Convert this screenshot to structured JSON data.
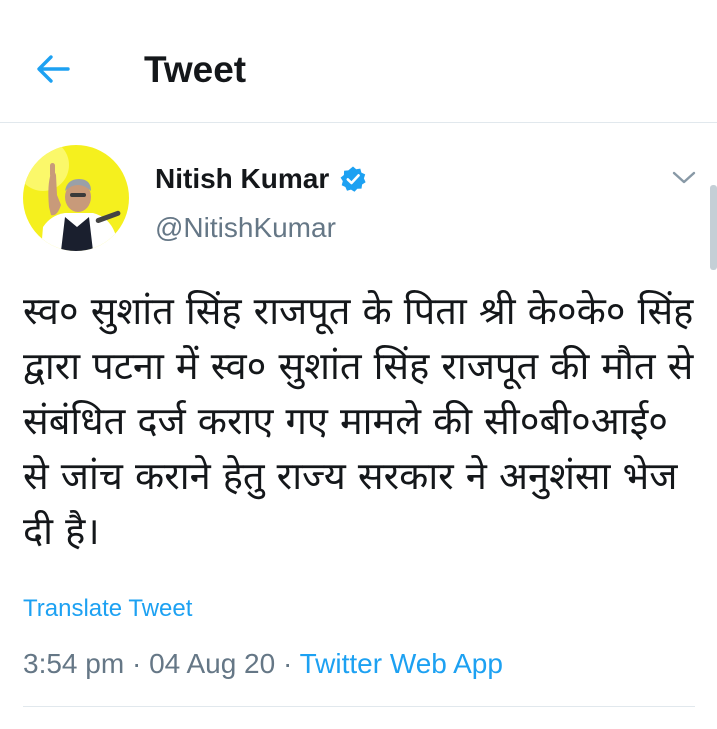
{
  "header": {
    "title": "Tweet",
    "back_icon": "arrow-left-icon"
  },
  "tweet": {
    "author_name": "Nitish Kumar",
    "author_handle": "@NitishKumar",
    "verified_icon": "verified-badge-icon",
    "text": "स्व० सुशांत सिंह राजपूत के पिता श्री के०के० सिंह द्वारा पटना में स्व० सुशांत सिंह राजपूत की मौत से संबंधित दर्ज कराए गए मामले की सी०बी०आई० से जांच कराने हेतु राज्य सरकार ने अनुशंसा भेज दी है।",
    "translate_label": "Translate Tweet",
    "time": "3:54 pm",
    "date": "04 Aug 20",
    "separator": " · ",
    "source": "Twitter Web App"
  },
  "colors": {
    "accent": "#1da1f2",
    "secondary_text": "#657786",
    "primary_text": "#14171a",
    "avatar_background": "#f5f01e",
    "divider": "#e1e8ed"
  }
}
